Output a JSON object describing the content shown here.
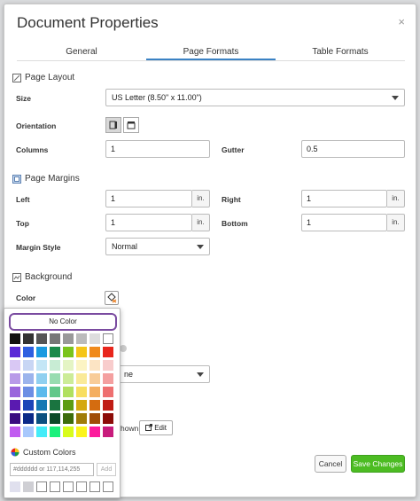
{
  "dialog": {
    "title": "Document Properties",
    "close_glyph": "×"
  },
  "tabs": [
    {
      "label": "General",
      "active": false
    },
    {
      "label": "Page Formats",
      "active": true
    },
    {
      "label": "Table Formats",
      "active": false
    }
  ],
  "page_layout": {
    "heading": "Page Layout",
    "size_label": "Size",
    "size_value": "US Letter (8.50\" x 11.00\")",
    "orientation_label": "Orientation",
    "columns_label": "Columns",
    "columns_value": "1",
    "gutter_label": "Gutter",
    "gutter_value": "0.5"
  },
  "page_margins": {
    "heading": "Page Margins",
    "left_label": "Left",
    "left_value": "1",
    "right_label": "Right",
    "right_value": "1",
    "top_label": "Top",
    "top_value": "1",
    "bottom_label": "Bottom",
    "bottom_value": "1",
    "unit": "in.",
    "margin_style_label": "Margin Style",
    "margin_style_value": "Normal"
  },
  "background": {
    "heading": "Background",
    "color_label": "Color",
    "partial_select_text": "ne",
    "partial_text": "hown",
    "edit_label": "Edit"
  },
  "footer": {
    "cancel_label": "Cancel",
    "save_label": "Save Changes"
  },
  "color_picker": {
    "no_color_label": "No Color",
    "custom_heading": "Custom Colors",
    "hex_placeholder": "#dddddd or 117,114,255",
    "add_label": "Add",
    "palette": [
      [
        "#111111",
        "#333333",
        "#555555",
        "#777777",
        "#999999",
        "#bbbbbb",
        "#dddddd",
        "#ffffff"
      ],
      [
        "#5b2ad6",
        "#2f5fe0",
        "#1a9ae0",
        "#1a8a4a",
        "#7ac41c",
        "#f5c518",
        "#f08a1c",
        "#e8261c"
      ],
      [
        "#d9c8f4",
        "#c8d6f4",
        "#c4e6f6",
        "#c8ecd4",
        "#e4f4c4",
        "#fcf4c4",
        "#fce4c4",
        "#f8cccc"
      ],
      [
        "#b89ae8",
        "#9cb4ec",
        "#90d0f0",
        "#98dcb0",
        "#ccec98",
        "#faea98",
        "#f8cc98",
        "#f4a0a0"
      ],
      [
        "#9a66dc",
        "#6c8ee4",
        "#5cbaec",
        "#62c88a",
        "#b0e060",
        "#f8de60",
        "#f4ae60",
        "#ee7070"
      ],
      [
        "#5a1ab0",
        "#1c44b8",
        "#1478b4",
        "#1a7440",
        "#5c9c14",
        "#d4a810",
        "#d46c10",
        "#c01c14"
      ],
      [
        "#3a0c80",
        "#0c2a88",
        "#0c5080",
        "#0c4a28",
        "#3c6c0c",
        "#a07c08",
        "#a04c08",
        "#8c0c08"
      ],
      [
        "#c05cf0",
        "#a8c8fc",
        "#44ecf8",
        "#1cf07c",
        "#d8fc1c",
        "#fcf41c",
        "#fc1c9c",
        "#c81c7c"
      ]
    ],
    "custom_swatches": [
      "#e0e0ee",
      "#cfcfd4",
      "#ffffff",
      "#ffffff",
      "#ffffff",
      "#ffffff",
      "#ffffff",
      "#ffffff"
    ]
  }
}
